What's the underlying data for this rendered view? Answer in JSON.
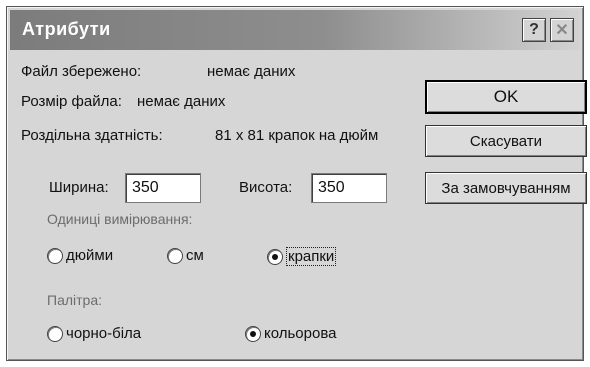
{
  "window": {
    "title": "Атрибути",
    "help_glyph": "?",
    "close_glyph": "✕"
  },
  "info": {
    "file_saved_label": "Файл збережено:",
    "file_saved_value": "немає даних",
    "file_size_label": "Розмір файла:",
    "file_size_value": "немає даних",
    "resolution_label": "Роздільна здатність:",
    "resolution_value": "81 x 81 крапок на дюйм"
  },
  "size": {
    "width_label": "Ширина:",
    "width_value": "350",
    "height_label": "Висота:",
    "height_value": "350"
  },
  "units": {
    "group_label": "Одиниці вимірювання:",
    "options": [
      {
        "label": "дюйми",
        "checked": false
      },
      {
        "label": "см",
        "checked": false
      },
      {
        "label": "крапки",
        "checked": true
      }
    ]
  },
  "palette": {
    "group_label": "Палітра:",
    "options": [
      {
        "label": "чорно-біла",
        "checked": false
      },
      {
        "label": "кольорова",
        "checked": true
      }
    ]
  },
  "buttons": {
    "ok": "OK",
    "cancel": "Скасувати",
    "default": "За замовчуванням"
  },
  "colors": {
    "dialog_bg": "#d6d6d6",
    "title_gradient_start": "#7c7c7c",
    "title_text": "#ffffff"
  }
}
